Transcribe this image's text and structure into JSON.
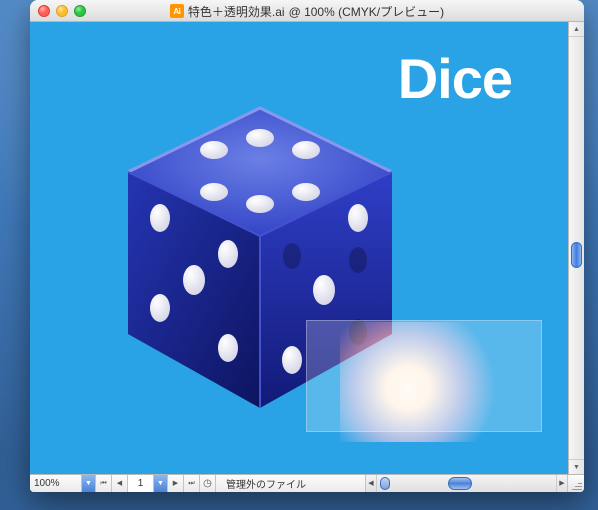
{
  "window": {
    "title_filename": "特色＋透明効果.ai",
    "title_suffix": " @ 100% (CMYK/プレビュー)"
  },
  "traffic_lights": {
    "close": "close",
    "minimize": "minimize",
    "zoom": "zoom"
  },
  "canvas": {
    "bg_color": "#2aa3e6",
    "heading": "Dice"
  },
  "statusbar": {
    "zoom": "100%",
    "page": "1",
    "status_text": "管理外のファイル"
  },
  "icons": {
    "ai": "Ai",
    "dropdown": "▼",
    "first": "⏮",
    "prev": "◀",
    "next": "▶",
    "last": "⏭",
    "clock": "◷",
    "arrow_left": "◀",
    "arrow_right": "▶",
    "arrow_up": "▲",
    "arrow_down": "▼"
  }
}
